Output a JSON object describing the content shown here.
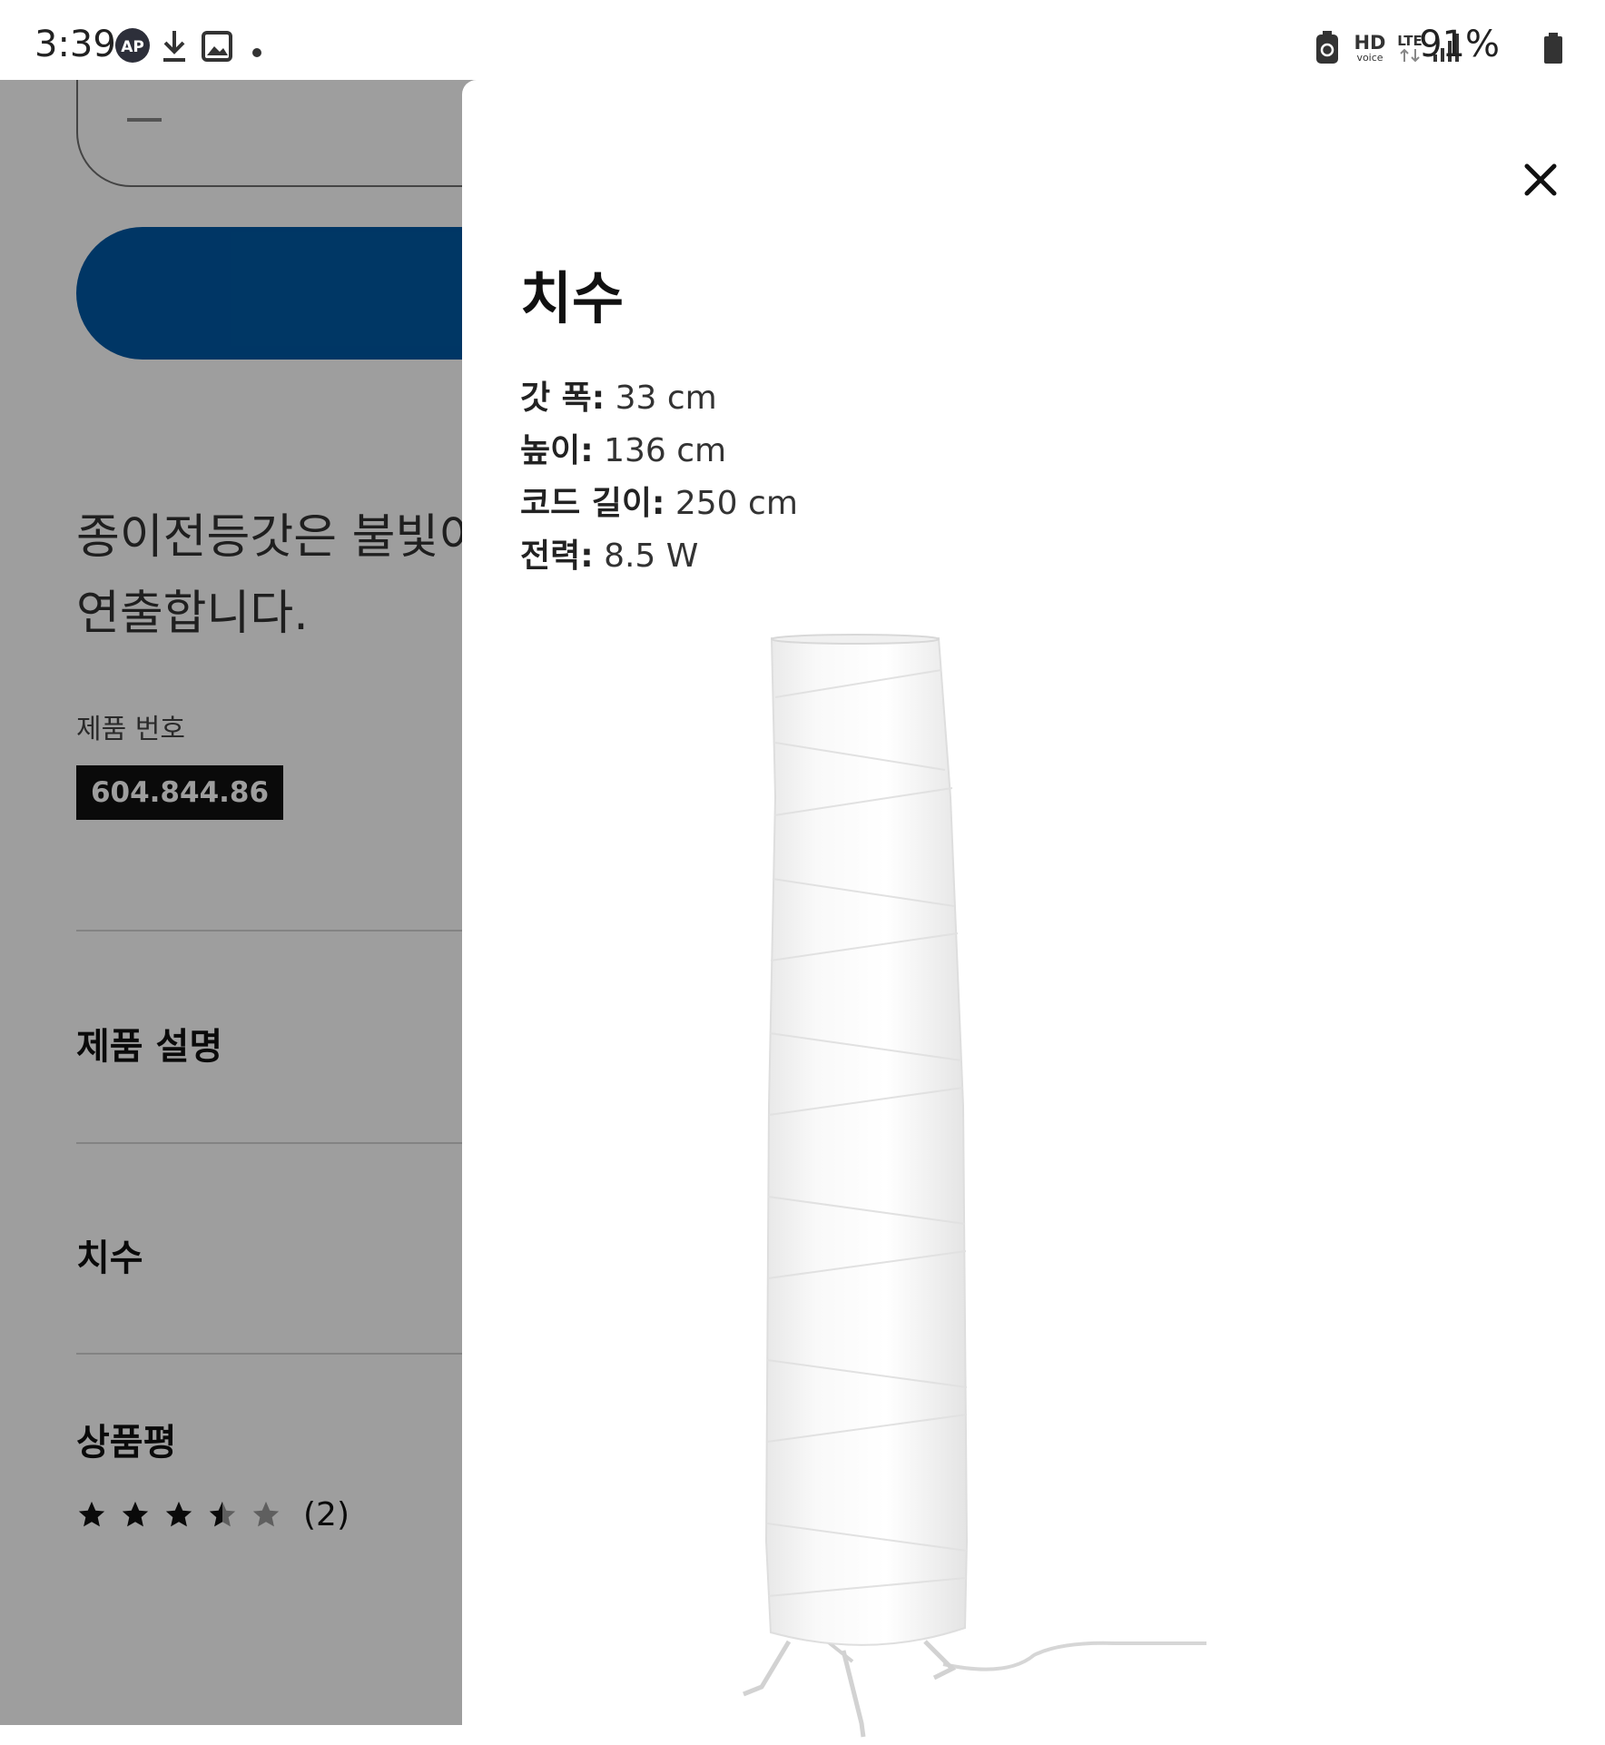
{
  "status_bar": {
    "time": "3:39",
    "left_icons": [
      "app-icon",
      "download-icon",
      "image-icon",
      "notification-dot-icon"
    ],
    "right_icons": [
      "battery-saver-icon",
      "hd-voice-icon",
      "lte-icon",
      "signal-icon",
      "battery-icon"
    ],
    "hd_label": "HD",
    "voice_label": "voice",
    "lte_label": "LTE",
    "battery_percent": "91%"
  },
  "background_page": {
    "description_text": "종이전등갓은 불빛이\n연출합니다.",
    "product_number_label": "제품 번호",
    "product_number": "604.844.86",
    "sections": {
      "description": "제품 설명",
      "dimensions": "치수",
      "reviews": "상품평"
    },
    "rating": {
      "stars": 3.5,
      "max": 5,
      "count_label": "(2)"
    }
  },
  "dimensions_sheet": {
    "title": "치수",
    "rows": [
      {
        "label": "갓 폭:",
        "value": " 33 cm"
      },
      {
        "label": "높이:",
        "value": " 136 cm"
      },
      {
        "label": "코드 길이:",
        "value": " 250 cm"
      },
      {
        "label": "전력:",
        "value": " 8.5 W"
      }
    ],
    "image": "floor-lamp-paper-shade"
  },
  "colors": {
    "buy_button": "#0058a3",
    "overlay": "rgba(0,0,0,0.38)",
    "badge_bg": "#111111"
  }
}
